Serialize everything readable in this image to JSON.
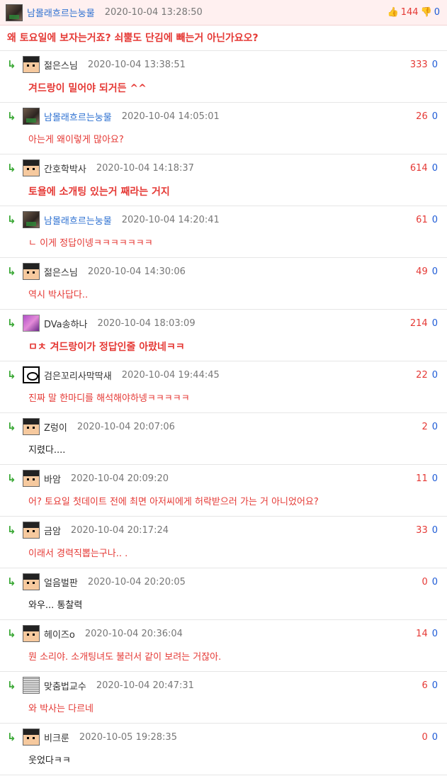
{
  "post": {
    "author": "남몰래흐르는눙물",
    "date": "2020-10-04 13:28:50",
    "up_count": "144",
    "down_count": "0",
    "title": "왜 토요일에 보자는거죠? 쇠뿔도 단김에 빼는거 아닌가요오?"
  },
  "comments": [
    {
      "author": "젊은스님",
      "date": "2020-10-04 13:38:51",
      "up": "333",
      "down": "0",
      "text": "겨드랑이 밀어야 되거든 ^^",
      "avatar": "pixel",
      "name_style": "plain",
      "text_style": "bold"
    },
    {
      "author": "남몰래흐르는눙물",
      "date": "2020-10-04 14:05:01",
      "up": "26",
      "down": "0",
      "text": "아는게 왜이렇게 많아요?",
      "avatar": "photo",
      "name_style": "link",
      "text_style": "normal"
    },
    {
      "author": "간호학박사",
      "date": "2020-10-04 14:18:37",
      "up": "614",
      "down": "0",
      "text": "토욜에 소개팅 있는거 째라는 거지",
      "avatar": "pixel",
      "name_style": "plain",
      "text_style": "bold"
    },
    {
      "author": "남몰래흐르는눙물",
      "date": "2020-10-04 14:20:41",
      "up": "61",
      "down": "0",
      "text": "ㄴ 이게 정답이넹ㅋㅋㅋㅋㅋㅋㅋ",
      "avatar": "photo",
      "name_style": "link",
      "text_style": "normal"
    },
    {
      "author": "젊은스님",
      "date": "2020-10-04 14:30:06",
      "up": "49",
      "down": "0",
      "text": "역시 박사답다..",
      "avatar": "pixel",
      "name_style": "plain",
      "text_style": "normal"
    },
    {
      "author": "DVa송하나",
      "date": "2020-10-04 18:03:09",
      "up": "214",
      "down": "0",
      "text": "ㅁㅊ 겨드랑이가 정답인줄 아랐네ㅋㅋ",
      "avatar": "anime",
      "name_style": "plain",
      "text_style": "bold"
    },
    {
      "author": "검은꼬리사막딱새",
      "date": "2020-10-04 19:44:45",
      "up": "22",
      "down": "0",
      "text": "진짜 말 한마디를 해석해야하넹ㅋㅋㅋㅋㅋ",
      "avatar": "sketch",
      "name_style": "plain",
      "text_style": "normal"
    },
    {
      "author": "Z렁이",
      "date": "2020-10-04 20:07:06",
      "up": "2",
      "down": "0",
      "text": "지렸다....",
      "avatar": "pixel",
      "name_style": "plain",
      "text_style": "black"
    },
    {
      "author": "바암",
      "date": "2020-10-04 20:09:20",
      "up": "11",
      "down": "0",
      "text": "어? 토요일 첫데이트 전에 최면 아저씨에게 허락받으러 가는 거 아니었어요?",
      "avatar": "pixel",
      "name_style": "plain",
      "text_style": "normal"
    },
    {
      "author": "금암",
      "date": "2020-10-04 20:17:24",
      "up": "33",
      "down": "0",
      "text": "이래서 경력직뽑는구나.. .",
      "avatar": "pixel",
      "name_style": "plain",
      "text_style": "normal"
    },
    {
      "author": "얼음벌판",
      "date": "2020-10-04 20:20:05",
      "up": "0",
      "down": "0",
      "text": "와우... 통찰력",
      "avatar": "pixel",
      "name_style": "plain",
      "text_style": "black"
    },
    {
      "author": "헤이즈o",
      "date": "2020-10-04 20:36:04",
      "up": "14",
      "down": "0",
      "text": "뭔 소리야. 소개팅녀도 불러서 같이 보려는 거잖아.",
      "avatar": "pixel",
      "name_style": "plain",
      "text_style": "normal"
    },
    {
      "author": "맞춤법교수",
      "date": "2020-10-04 20:47:31",
      "up": "6",
      "down": "0",
      "text": "와 박사는 다르네",
      "avatar": "text",
      "name_style": "plain",
      "text_style": "normal"
    },
    {
      "author": "비크룬",
      "date": "2020-10-05 19:28:35",
      "up": "0",
      "down": "0",
      "text": "웃었다ㅋㅋ",
      "avatar": "pixel",
      "name_style": "plain",
      "text_style": "black"
    }
  ],
  "icons": {
    "reply": "reply-arrow-icon",
    "up": "thumbs-up-icon",
    "down": "thumbs-down-icon"
  },
  "colors": {
    "accent_red": "#e53935",
    "link_blue": "#2b6fd1",
    "reply_green": "#3aa835",
    "header_bg": "#fff0f0"
  }
}
